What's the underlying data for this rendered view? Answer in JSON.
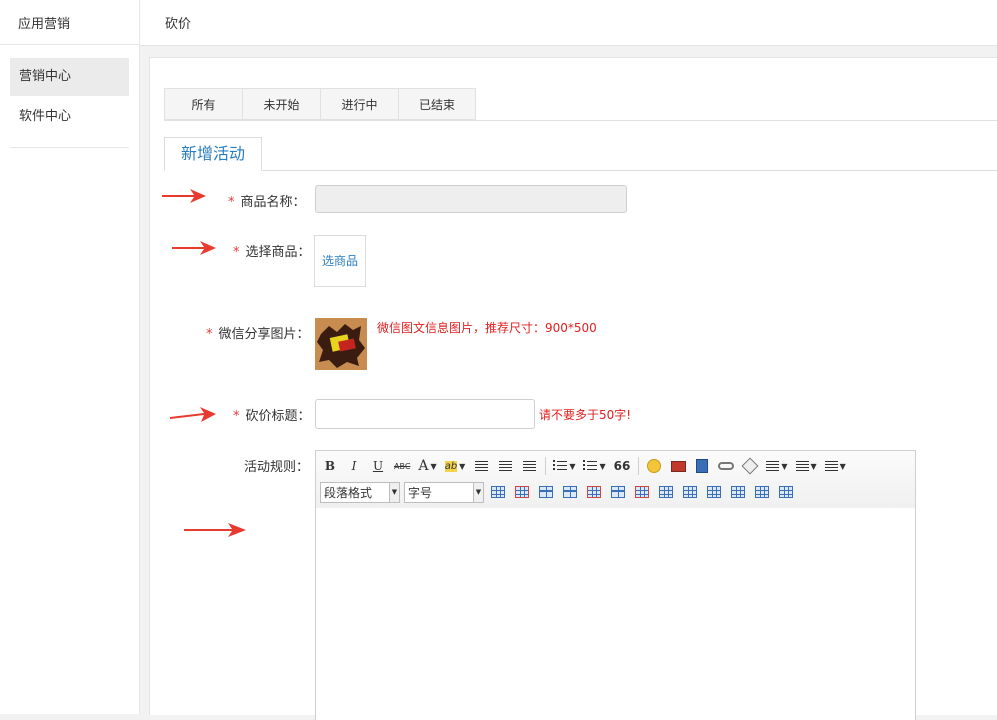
{
  "sidebar": {
    "title": "应用营销",
    "items": [
      {
        "label": "营销中心",
        "active": true
      },
      {
        "label": "软件中心",
        "active": false
      }
    ]
  },
  "header": {
    "title": "砍价"
  },
  "tabs": [
    "所有",
    "未开始",
    "进行中",
    "已结束"
  ],
  "subtab": "新增活动",
  "form": {
    "required_mark": "*",
    "product_name_label": "商品名称：",
    "product_name_value": "",
    "select_product_label": "选择商品：",
    "select_product_button": "选商品",
    "share_image_label": "微信分享图片：",
    "share_image_hint": "微信图文信息图片，推荐尺寸：900*500",
    "title_label": "砍价标题：",
    "title_value": "",
    "title_hint": "请不要多于50字!",
    "rules_label": "活动规则："
  },
  "editor": {
    "paragraph_format": "段落格式",
    "font_size": "字号",
    "bold": "B",
    "italic": "I",
    "underline": "U",
    "strikethrough": "ABC",
    "font_color": "A",
    "highlight": "ab",
    "blockquote": "66"
  },
  "colors": {
    "accent": "#2a7dc0",
    "required": "#e4393c",
    "hint": "#e01f1f",
    "arrow": "#e83a2e"
  }
}
